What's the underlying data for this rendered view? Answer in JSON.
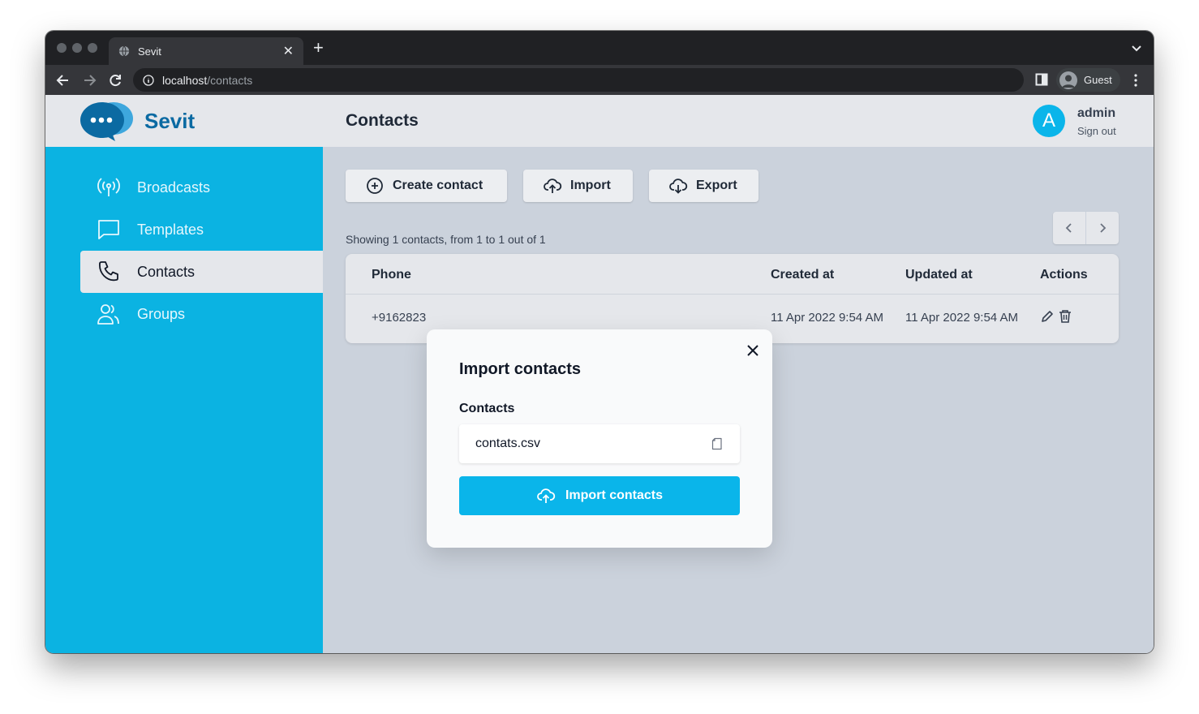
{
  "browser": {
    "tab_title": "Sevit",
    "url_host": "localhost",
    "url_path": "/contacts",
    "profile_label": "Guest"
  },
  "header": {
    "brand": "Sevit",
    "page_title": "Contacts",
    "user_initial": "A",
    "user_name": "admin",
    "sign_out_label": "Sign out"
  },
  "sidebar": {
    "items": [
      {
        "label": "Broadcasts",
        "icon": "broadcast-icon"
      },
      {
        "label": "Templates",
        "icon": "chat-bubble-icon"
      },
      {
        "label": "Contacts",
        "icon": "phone-icon",
        "active": true
      },
      {
        "label": "Groups",
        "icon": "users-icon"
      }
    ]
  },
  "toolbar": {
    "create_label": "Create contact",
    "import_label": "Import",
    "export_label": "Export"
  },
  "listing": {
    "summary": "Showing 1 contacts, from 1 to 1 out of 1"
  },
  "table": {
    "headers": {
      "phone": "Phone",
      "created": "Created at",
      "updated": "Updated at",
      "actions": "Actions"
    },
    "rows": [
      {
        "phone": "+9162823",
        "created": "11 Apr 2022 9:54 AM",
        "updated": "11 Apr 2022 9:54 AM"
      }
    ]
  },
  "modal": {
    "title": "Import contacts",
    "field_label": "Contacts",
    "file_value": "contats.csv",
    "submit_label": "Import contacts"
  },
  "colors": {
    "accent": "#0ab5ea",
    "brand": "#0b6aa2",
    "sidebar_bg": "#0bb3e2"
  }
}
